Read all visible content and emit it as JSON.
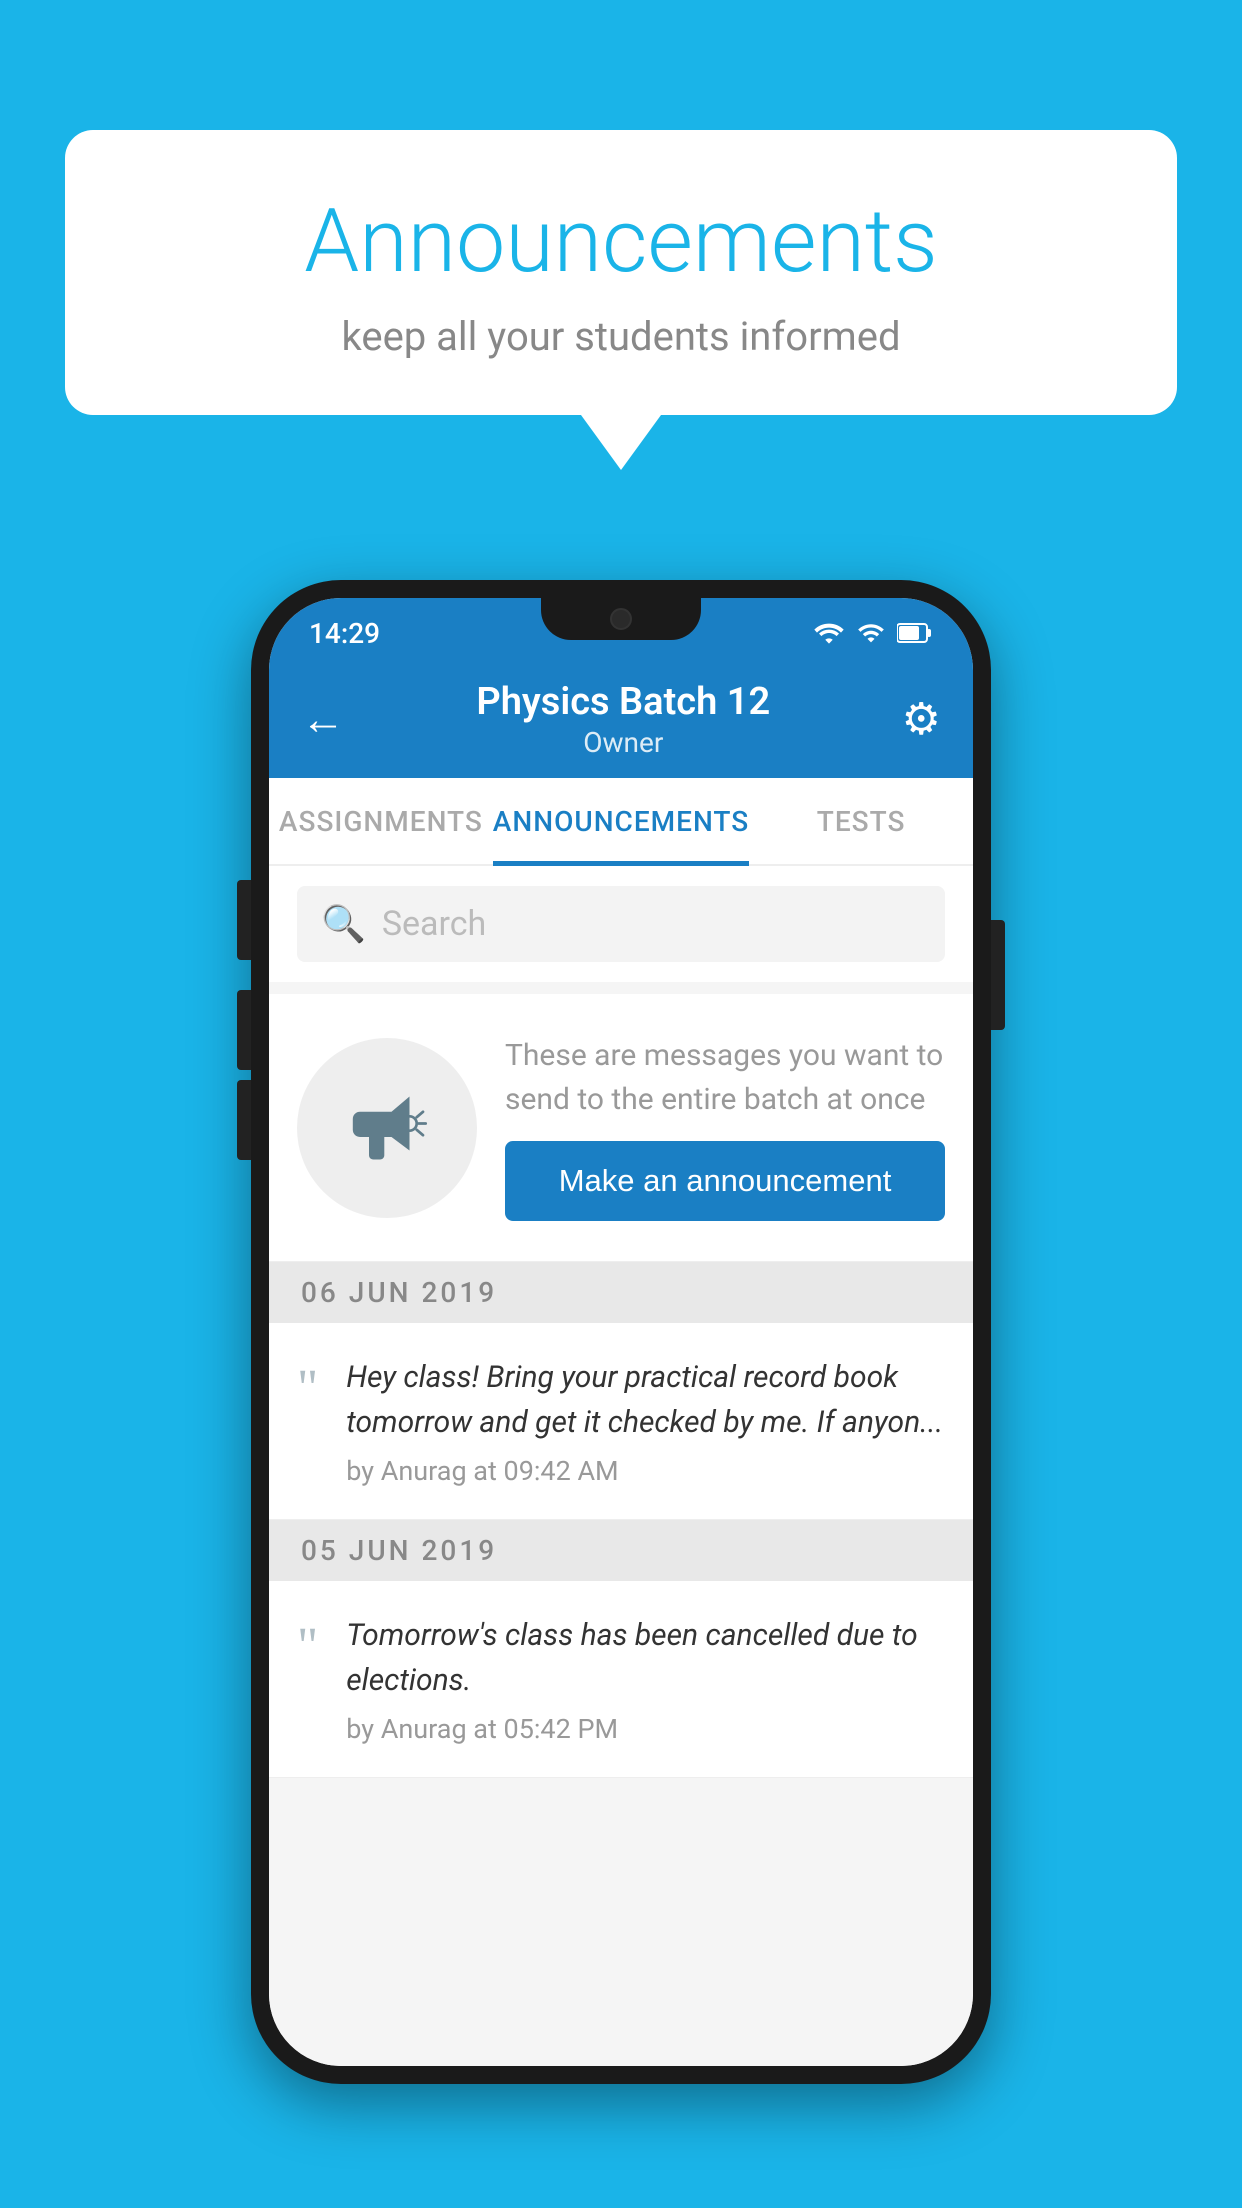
{
  "background_color": "#1ab4e8",
  "speech_bubble": {
    "title": "Announcements",
    "subtitle": "keep all your students informed"
  },
  "phone": {
    "status_bar": {
      "time": "14:29"
    },
    "app_bar": {
      "title": "Physics Batch 12",
      "subtitle": "Owner",
      "back_label": "←",
      "gear_label": "⚙"
    },
    "tabs": [
      {
        "label": "ASSIGNMENTS",
        "active": false
      },
      {
        "label": "ANNOUNCEMENTS",
        "active": true
      },
      {
        "label": "TESTS",
        "active": false
      }
    ],
    "search": {
      "placeholder": "Search"
    },
    "announcement_prompt": {
      "hint": "These are messages you want to send to the entire batch at once",
      "button_label": "Make an announcement"
    },
    "announcements": [
      {
        "date": "06  JUN  2019",
        "messages": [
          {
            "text": "Hey class! Bring your practical record book tomorrow and get it checked by me. If anyon...",
            "meta": "by Anurag at 09:42 AM"
          }
        ]
      },
      {
        "date": "05  JUN  2019",
        "messages": [
          {
            "text": "Tomorrow's class has been cancelled due to elections.",
            "meta": "by Anurag at 05:42 PM"
          }
        ]
      }
    ]
  }
}
